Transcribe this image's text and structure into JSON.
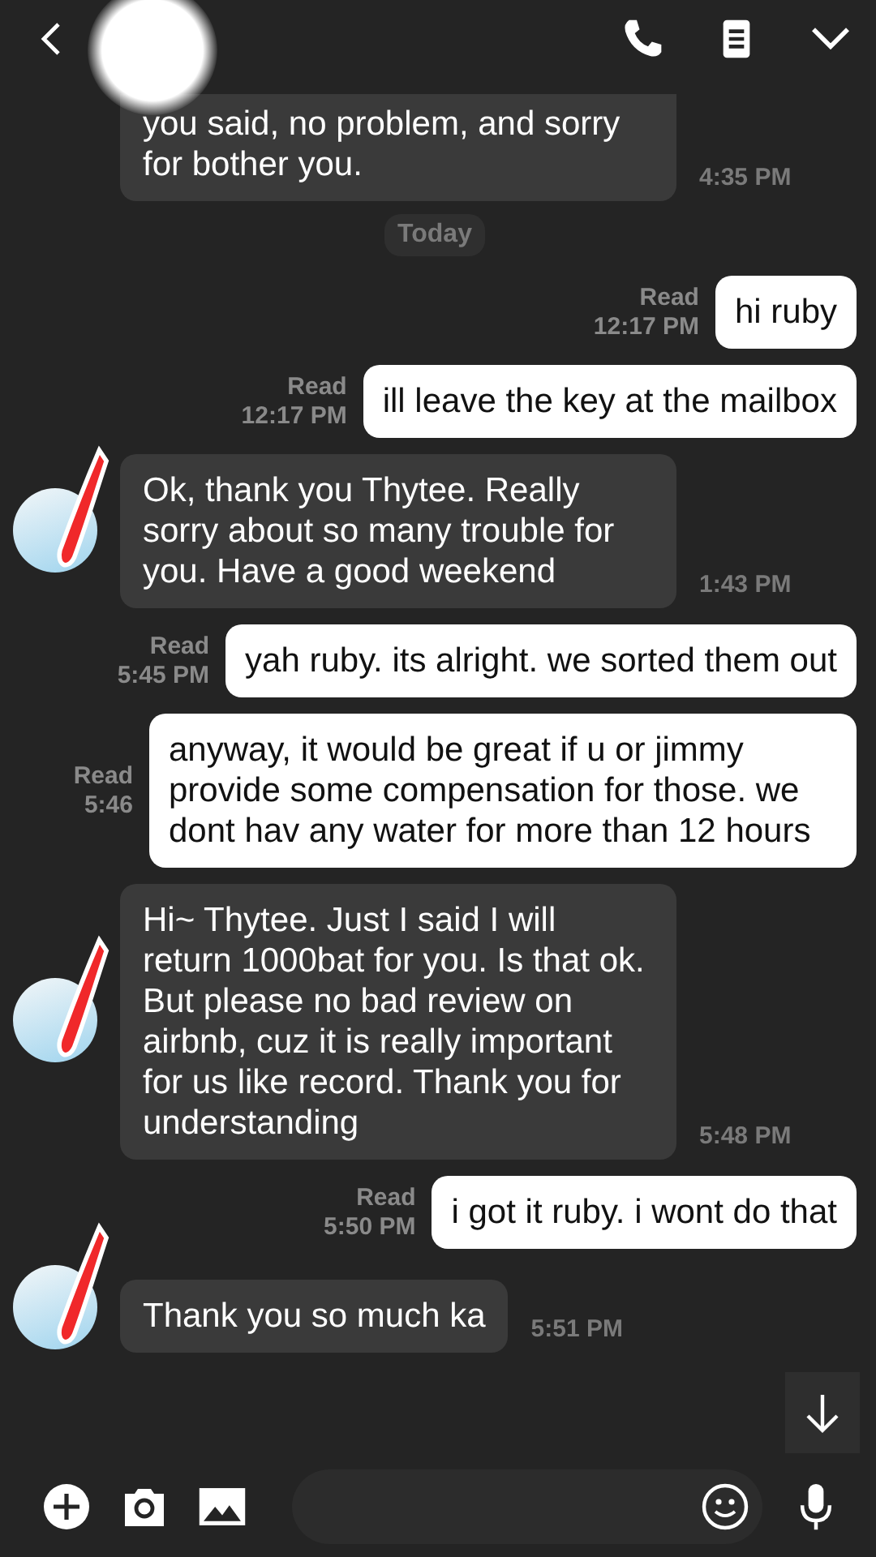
{
  "messages": [
    {
      "kind": "incoming",
      "text": "you said, no problem, and sorry for bother you.",
      "time": "4:35 PM",
      "avatar": false,
      "redacted": false,
      "cut_top": true
    },
    {
      "kind": "date",
      "text": "Today"
    },
    {
      "kind": "outgoing",
      "text": "hi ruby",
      "status": "Read",
      "time": "12:17 PM"
    },
    {
      "kind": "outgoing",
      "text": "ill leave the key at the mailbox",
      "status": "Read",
      "time": "12:17 PM"
    },
    {
      "kind": "incoming",
      "text": "Ok, thank you Thytee. Really sorry about so many trouble for you. Have a good weekend",
      "time": "1:43 PM",
      "avatar": true,
      "redacted": true,
      "cut_top": false
    },
    {
      "kind": "outgoing",
      "text": "yah ruby. its alright. we sorted them out",
      "status": "Read",
      "time": "5:45 PM"
    },
    {
      "kind": "outgoing",
      "text": "anyway, it would be great if u or jimmy provide some compensation for those. we dont hav any water for more than 12 hours",
      "status": "Read",
      "time": "5:46"
    },
    {
      "kind": "incoming",
      "text": "Hi~ Thytee. Just I said I will return 1000bat for you. Is that ok. But please no bad review on airbnb, cuz it is really important for us like record. Thank you for understanding",
      "time": "5:48 PM",
      "avatar": true,
      "redacted": true,
      "cut_top": false
    },
    {
      "kind": "outgoing",
      "text": "i got it ruby. i wont do that",
      "status": "Read",
      "time": "5:50 PM"
    },
    {
      "kind": "incoming",
      "text": "Thank you so much ka",
      "time": "5:51 PM",
      "avatar": true,
      "redacted": true,
      "cut_top": false
    }
  ]
}
